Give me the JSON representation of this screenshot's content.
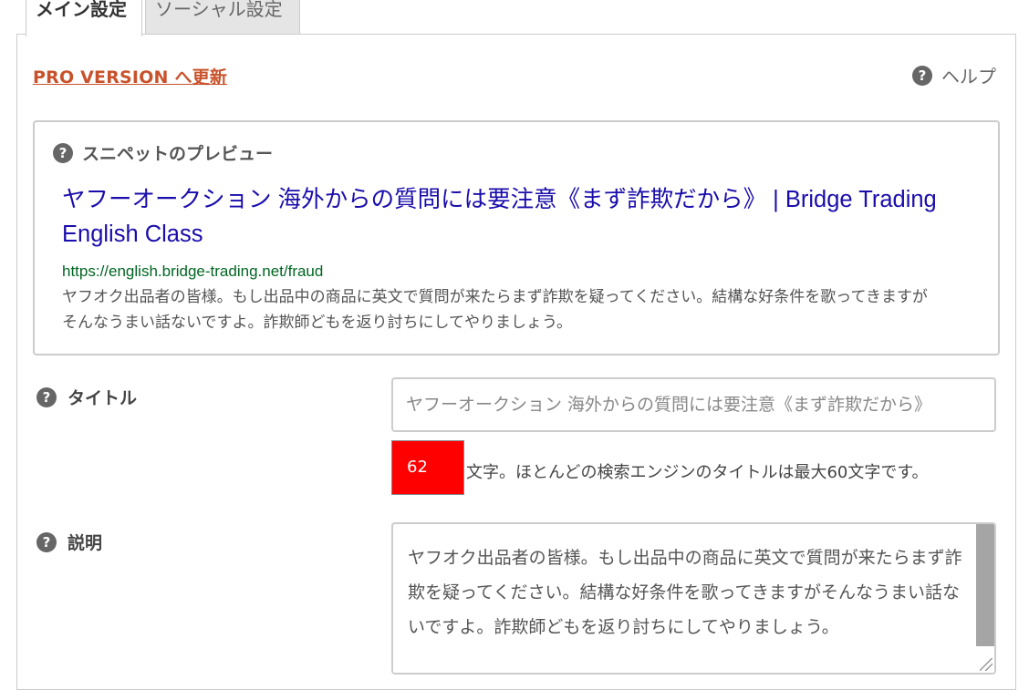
{
  "tabs": [
    {
      "label": "メイン設定",
      "active": true
    },
    {
      "label": "ソーシャル設定",
      "active": false
    }
  ],
  "pro_link": "PRO VERSION へ更新",
  "help": {
    "label": "ヘルプ",
    "icon": "help-circle-icon"
  },
  "preview": {
    "heading": "スニペットのプレビュー",
    "title": "ヤフーオークション 海外からの質問には要注意《まず詐欺だから》 | Bridge Trading English Class",
    "url": "https://english.bridge-trading.net/fraud",
    "description": "ヤフオク出品者の皆様。もし出品中の商品に英文で質問が来たらまず詐欺を疑ってください。結構な好条件を歌ってきますがそんなうまい話ないですよ。詐欺師どもを返り討ちにしてやりましょう。"
  },
  "title_field": {
    "label": "タイトル",
    "value": "ヤフーオークション 海外からの質問には要注意《まず詐欺だから》",
    "char_count": "62",
    "char_note": "文字。ほとんどの検索エンジンのタイトルは最大60文字です。",
    "counter_color": "#ff0000"
  },
  "description_field": {
    "label": "説明",
    "value": "ヤフオク出品者の皆様。もし出品中の商品に英文で質問が来たらまず詐欺を疑ってください。結構な好条件を歌ってきますがそんなうまい話ないですよ。詐欺師どもを返り討ちにしてやりましょう。"
  },
  "colors": {
    "pro_link": "#c8522b",
    "snippet_title": "#1a0dab",
    "snippet_url": "#006621"
  }
}
